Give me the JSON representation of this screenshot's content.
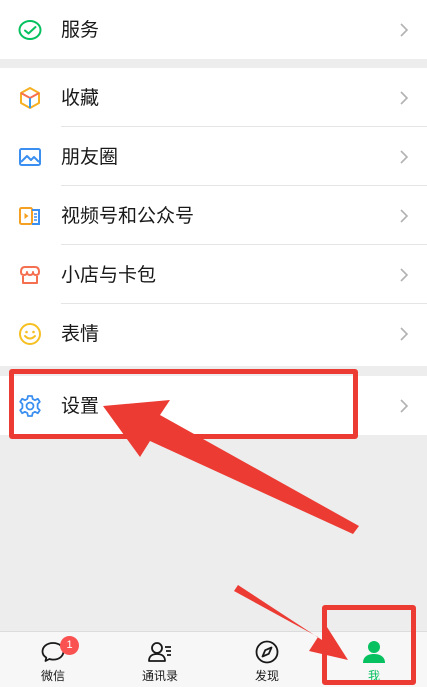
{
  "menu": {
    "services": {
      "label": "服务",
      "icon": "services-icon"
    },
    "favorites": {
      "label": "收藏",
      "icon": "favorites-cube-icon"
    },
    "moments": {
      "label": "朋友圈",
      "icon": "moments-image-icon"
    },
    "channels": {
      "label": "视频号和公众号",
      "icon": "channels-icon"
    },
    "shop": {
      "label": "小店与卡包",
      "icon": "shop-card-icon"
    },
    "stickers": {
      "label": "表情",
      "icon": "sticker-smiley-icon"
    },
    "settings": {
      "label": "设置",
      "icon": "settings-gear-icon"
    }
  },
  "tabbar": {
    "chats": {
      "label": "微信",
      "badge": "1",
      "icon": "chat-bubble-icon"
    },
    "contacts": {
      "label": "通讯录",
      "icon": "contacts-icon"
    },
    "discover": {
      "label": "发现",
      "icon": "compass-icon"
    },
    "me": {
      "label": "我",
      "icon": "person-icon",
      "active": true
    }
  },
  "colors": {
    "accent_green": "#07c160",
    "annotation_red": "#ec3b33",
    "badge_red": "#fa5151",
    "background": "#ededed"
  }
}
